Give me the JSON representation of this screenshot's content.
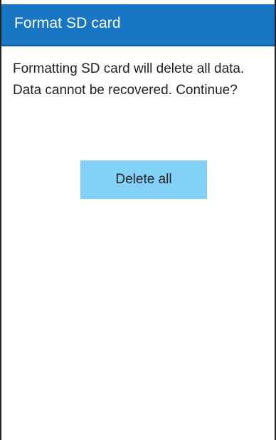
{
  "app_bar": {
    "title": "Format SD card"
  },
  "dialog": {
    "message": "Formatting SD card will delete all data. Data cannot be recovered. Continue?",
    "confirm_label": "Delete all"
  },
  "colors": {
    "app_bar": "#1976c4",
    "button": "#84d1f7",
    "text": "#222222"
  }
}
